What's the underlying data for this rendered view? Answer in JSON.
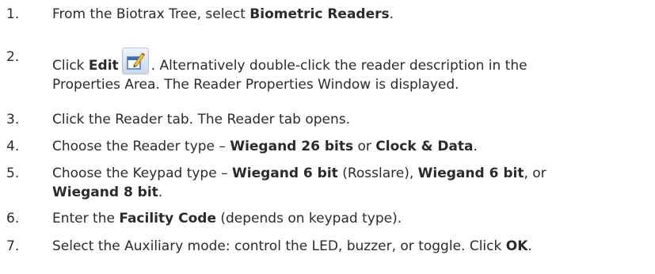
{
  "steps": [
    {
      "num": "1.",
      "parts": [
        "From the Biotrax Tree, select ",
        "Biometric Readers",
        "."
      ]
    },
    {
      "num": "2.",
      "parts": [
        "Click ",
        "Edit",
        ". Alternatively double-click the reader description in the",
        "Properties Area. The Reader Properties Window is displayed."
      ],
      "icon": "edit-icon"
    },
    {
      "num": "3.",
      "parts": [
        "Click the Reader tab. The Reader tab opens."
      ]
    },
    {
      "num": "4.",
      "parts": [
        "Choose the Reader type – ",
        "Wiegand 26 bits",
        " or ",
        "Clock & Data",
        "."
      ]
    },
    {
      "num": "5.",
      "parts": [
        "Choose the Keypad type – ",
        "Wiegand 6 bit",
        " (Rosslare), ",
        "Wiegand 6 bit",
        ", or",
        "Wiegand 8 bit",
        "."
      ]
    },
    {
      "num": "6.",
      "parts": [
        "Enter the ",
        "Facility Code",
        " (depends on keypad type)."
      ]
    },
    {
      "num": "7.",
      "parts": [
        "Select the Auxiliary mode: control the LED, buzzer, or toggle. Click ",
        "OK",
        "."
      ]
    }
  ]
}
